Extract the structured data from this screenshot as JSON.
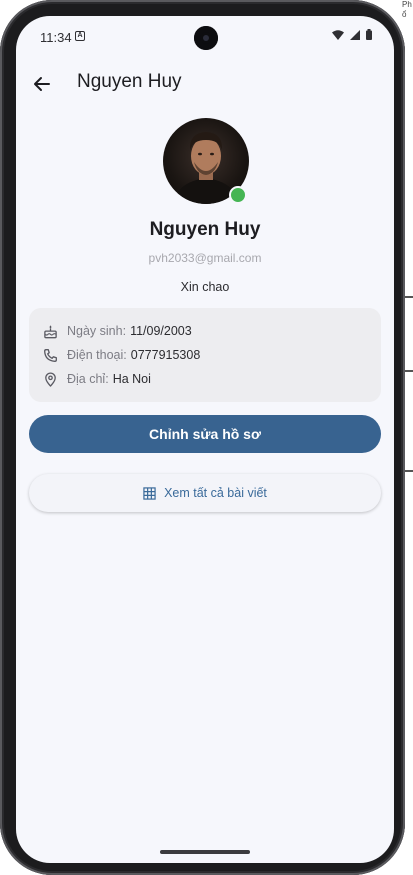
{
  "status_bar": {
    "time": "11:34",
    "notification_icon": "A"
  },
  "app_bar": {
    "title": "Nguyen Huy",
    "back_icon": "arrow-left-icon"
  },
  "profile": {
    "name": "Nguyen Huy",
    "email": "pvh2033@gmail.com",
    "bio": "Xin chao",
    "online": true,
    "online_color": "#45b553"
  },
  "info": [
    {
      "icon": "cake-icon",
      "label": "Ngày sinh:",
      "value": "11/09/2003"
    },
    {
      "icon": "phone-icon",
      "label": "Điện thoại:",
      "value": "0777915308"
    },
    {
      "icon": "location-pin-icon",
      "label": "Địa chỉ:",
      "value": "Ha Noi"
    }
  ],
  "actions": {
    "edit_profile": "Chỉnh sửa hồ sơ",
    "view_all_posts": "Xem tất cả bài viết"
  },
  "edge_text": {
    "line1": "Ph",
    "line2": "ổ"
  },
  "colors": {
    "primary": "#386390",
    "background": "#f6f7fc",
    "card": "#ededf0"
  }
}
